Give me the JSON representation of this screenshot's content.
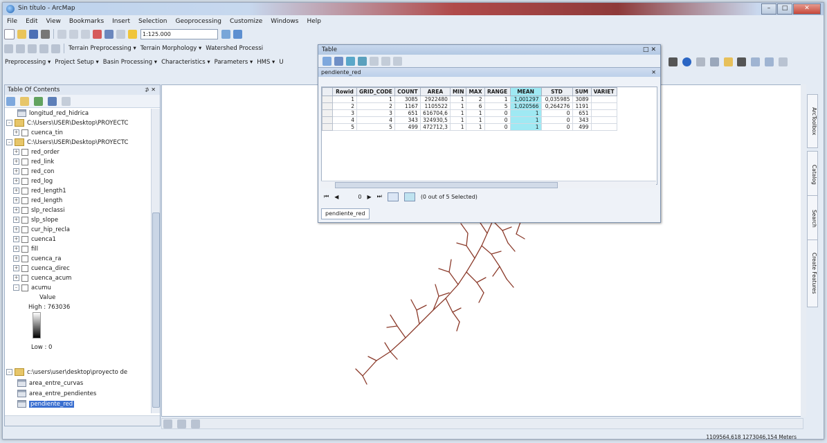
{
  "window": {
    "title": "Sin título - ArcMap",
    "min": "–",
    "max": "□",
    "close": "✕"
  },
  "menu": [
    "File",
    "Edit",
    "View",
    "Bookmarks",
    "Insert",
    "Selection",
    "Geoprocessing",
    "Customize",
    "Windows",
    "Help"
  ],
  "toolbar": {
    "scale_value": "1:125.000",
    "row2_items": [
      "Terrain Preprocessing ▾",
      "Terrain Morphology ▾",
      "Watershed Processi"
    ],
    "row3_items": [
      "Preprocessing ▾",
      "Project Setup ▾",
      "Basin Processing ▾",
      "Characteristics ▾",
      "Parameters ▾",
      "HMS ▾",
      "U"
    ]
  },
  "toc": {
    "title": "Table Of Contents",
    "pin": "⊅ ✕",
    "items": [
      {
        "type": "table",
        "label": "longitud_red_hidrica"
      },
      {
        "type": "folder",
        "label": "C:\\Users\\USER\\Desktop\\PROYECTC"
      },
      {
        "type": "layer",
        "label": "cuenca_tin"
      },
      {
        "type": "folder",
        "label": "C:\\Users\\USER\\Desktop\\PROYECTC"
      },
      {
        "type": "layer",
        "label": "red_order"
      },
      {
        "type": "layer",
        "label": "red_link"
      },
      {
        "type": "layer",
        "label": "red_con"
      },
      {
        "type": "layer",
        "label": "red_log"
      },
      {
        "type": "layer",
        "label": "red_length1"
      },
      {
        "type": "layer",
        "label": "red_length"
      },
      {
        "type": "layer",
        "label": "slp_reclassi"
      },
      {
        "type": "layer",
        "label": "slp_slope"
      },
      {
        "type": "layer",
        "label": "cur_hip_recla"
      },
      {
        "type": "layer",
        "label": "cuenca1"
      },
      {
        "type": "layer",
        "label": "fill"
      },
      {
        "type": "layer",
        "label": "cuenca_ra"
      },
      {
        "type": "layer",
        "label": "cuenca_direc"
      },
      {
        "type": "layer",
        "label": "cuenca_acum"
      },
      {
        "type": "layer",
        "label": "acumu"
      }
    ],
    "legend": {
      "value": "Value",
      "high": "High : 763036",
      "low": "Low : 0"
    },
    "folder3": "c:\\users\\user\\desktop\\proyecto de",
    "tables": [
      "area_entre_curvas",
      "area_entre_pendientes",
      "pendiente_red"
    ]
  },
  "table_window": {
    "title": "Table",
    "tab_name": "pendiente_red",
    "columns": [
      "Rowid",
      "GRID_CODE",
      "COUNT",
      "AREA",
      "MIN",
      "MAX",
      "RANGE",
      "MEAN",
      "STD",
      "SUM",
      "VARIET"
    ],
    "rows": [
      [
        "1",
        "1",
        "3085",
        "2922480",
        "1",
        "2",
        "1",
        "1,001297",
        "0,035985",
        "3089",
        ""
      ],
      [
        "2",
        "2",
        "1167",
        "1105522",
        "1",
        "6",
        "5",
        "1,020566",
        "0,264276",
        "1191",
        ""
      ],
      [
        "3",
        "3",
        "651",
        "616704,6",
        "1",
        "1",
        "0",
        "1",
        "0",
        "651",
        ""
      ],
      [
        "4",
        "4",
        "343",
        "324930,5",
        "1",
        "1",
        "0",
        "1",
        "0",
        "343",
        ""
      ],
      [
        "5",
        "5",
        "499",
        "472712,3",
        "1",
        "1",
        "0",
        "1",
        "0",
        "499",
        ""
      ]
    ],
    "record_number": "0",
    "selection_status": "(0 out of 5 Selected)",
    "bottom_tab": "pendiente_red"
  },
  "dock_tabs": [
    "ArcToolbox",
    "Catalog",
    "Search",
    "Create Features"
  ],
  "status": {
    "coordinates": "1109564,618  1273046,154 Meters"
  },
  "colors": {
    "network": "#8b3a2a",
    "mean_highlight": "#9fe9f3",
    "selection": "#3a6fd0"
  }
}
